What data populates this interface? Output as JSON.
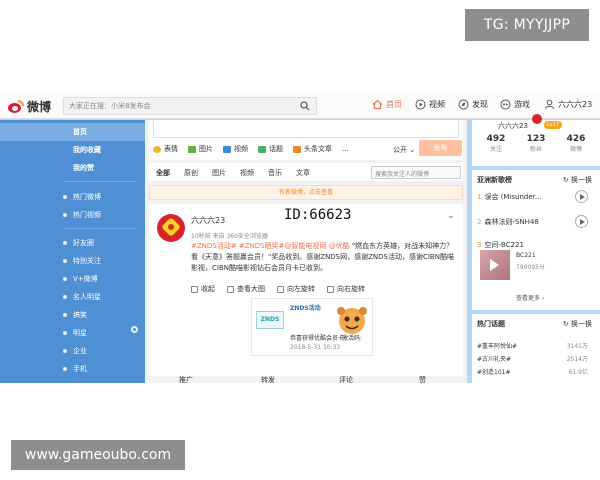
{
  "watermarks": {
    "top": "TG: MYYJJPP",
    "bottom": "www.gameoubo.com"
  },
  "topbar": {
    "logo": "微博",
    "search_placeholder": "大家正在搜：小米8发布会",
    "nav": [
      {
        "label": "首页",
        "icon": "home-icon"
      },
      {
        "label": "视频",
        "icon": "video-icon"
      },
      {
        "label": "发现",
        "icon": "discover-icon"
      },
      {
        "label": "游戏",
        "icon": "game-icon"
      },
      {
        "label": "六六六23",
        "icon": "user-icon"
      }
    ]
  },
  "sidebar": {
    "items": [
      {
        "label": "首页",
        "selected": true,
        "bold": true
      },
      {
        "label": "我的收藏",
        "bold": true
      },
      {
        "label": "我的赞",
        "bold": true
      },
      {
        "label": "热门微博"
      },
      {
        "label": "热门视频"
      },
      {
        "label": "好友圈"
      },
      {
        "label": "特别关注"
      },
      {
        "label": "V+微博"
      },
      {
        "label": "名人明星"
      },
      {
        "label": "搞笑"
      },
      {
        "label": "明星"
      },
      {
        "label": "企业"
      },
      {
        "label": "手机"
      }
    ]
  },
  "composer": {
    "tools": [
      "表情",
      "图片",
      "视频",
      "话题",
      "头条文章"
    ],
    "more": "...",
    "scope": "公开",
    "publish": "发布"
  },
  "feed_tabs": {
    "tabs": [
      "全部",
      "原创",
      "图片",
      "视频",
      "音乐",
      "文章"
    ],
    "search_placeholder": "搜索我关注人的微博"
  },
  "new_notice": "有新微博，点击查看",
  "post": {
    "user": "六六六23",
    "id_tag": "ID:66623",
    "meta": "10秒前 来自 360安全浏览器",
    "tags": "#ZNDS活动# #ZNDS晒奖#@智能电视网 @优酷",
    "text": " \"燃血东方英雄，对战未知神力？看《天意》答题赢会员！\"奖品收到。感谢ZNDS网，感谢ZNDS活动，感谢CIBN酷喵影视，CIBN酷喵影视钻石会员月卡已收到。",
    "actions": [
      "收起",
      "查看大图",
      "向左旋转",
      "向右旋转"
    ],
    "card_logo": "ZNDS",
    "card_title": "ZNDS活动",
    "card_body": "恭喜获得优酷会员卡",
    "card_date": "2018-5-31 10:33",
    "card_more": "激活码:",
    "footer": [
      "推广",
      "转发",
      "评论",
      "赞"
    ]
  },
  "profile": {
    "name": "六六六23",
    "level": "Lv17",
    "stats": [
      {
        "value": "492",
        "label": "关注"
      },
      {
        "value": "123",
        "label": "粉丝"
      },
      {
        "value": "426",
        "label": "微博"
      }
    ]
  },
  "music_chart": {
    "title": "亚洲新歌榜",
    "refresh": "换一换",
    "songs": [
      {
        "rank": "1",
        "name": "误会 (Misunder..."
      },
      {
        "rank": "2",
        "name": "森林法则-SNH48"
      },
      {
        "rank": "3",
        "name": "空间-BC221"
      }
    ],
    "featured_artist": "BC221",
    "featured_plays": "790095分",
    "more": "查看更多 ›"
  },
  "hot_topics": {
    "title": "热门话题",
    "refresh": "换一换",
    "items": [
      {
        "name": "#重丰阿悦仙#",
        "value": "3141万"
      },
      {
        "name": "#古川礼央#",
        "value": "2514万"
      },
      {
        "name": "#创造101#",
        "value": "61.9亿"
      }
    ]
  }
}
